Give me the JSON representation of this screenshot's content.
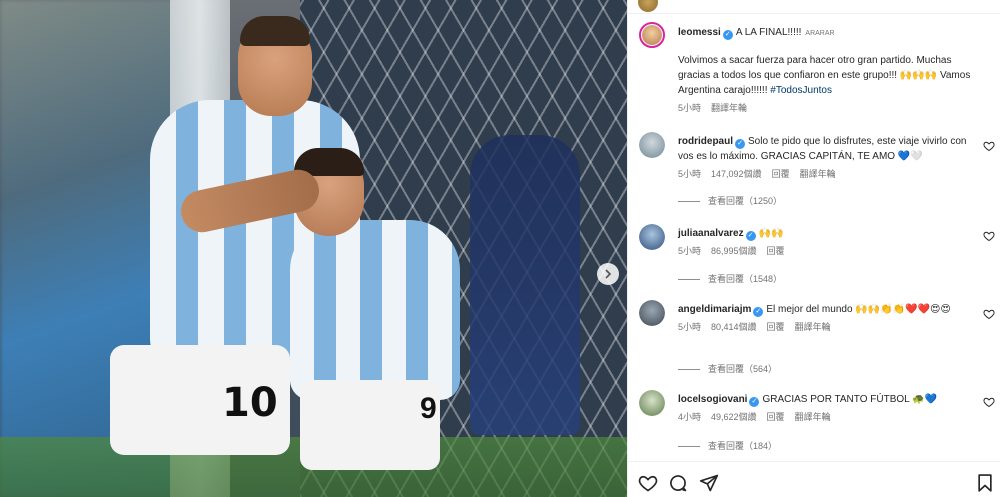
{
  "media": {
    "jersey_number_1": "10",
    "jersey_number_2": "9"
  },
  "post": {
    "username": "leomessi",
    "title": "A LA FINAL!!!!!",
    "tiny_mark": "ARARAR",
    "caption": "Volvimos a sacar fuerza para hacer otro gran partido. Muchas gracias a todos los que confiaron en este grupo!!! 🙌🙌🙌 Vamos Argentina carajo!!!!!! ",
    "hashtag": "#TodosJuntos",
    "time": "5小時",
    "translate": "翻譯年輪"
  },
  "comments": [
    {
      "username": "rodridepaul",
      "text": "Solo te pido que lo disfrutes, este viaje vivirlo con vos es lo máximo. GRACIAS CAPITÁN, TE AMO 💙🤍",
      "time": "5小時",
      "likes": "147,092個讚",
      "reply": "回覆",
      "translate": "翻譯年輪",
      "view_replies": "查看回覆（1250）"
    },
    {
      "username": "juliaanalvarez",
      "text": "🙌🙌",
      "time": "5小時",
      "likes": "86,995個讚",
      "reply": "回覆",
      "translate": "",
      "view_replies": "查看回覆（1548）"
    },
    {
      "username": "angeldimariajm",
      "text": "El mejor del mundo 🙌🙌👏👏❤️❤️😍😍",
      "time": "5小時",
      "likes": "80,414個讚",
      "reply": "回覆",
      "translate": "翻譯年輪",
      "view_replies": "查看回覆（564）"
    },
    {
      "username": "locelsogiovani",
      "text": "GRACIAS POR TANTO FÚTBOL 🐢💙",
      "time": "4小時",
      "likes": "49,622個讚",
      "reply": "回覆",
      "translate": "翻譯年輪",
      "view_replies": "查看回覆（184）"
    }
  ],
  "icons": {
    "like": "heart-outline-icon",
    "comment": "comment-icon",
    "share": "send-icon",
    "save": "bookmark-icon",
    "next": "chevron-right-icon"
  },
  "colors": {
    "verified": "#3897f0",
    "hashtag": "#00376b",
    "muted": "#737373"
  }
}
